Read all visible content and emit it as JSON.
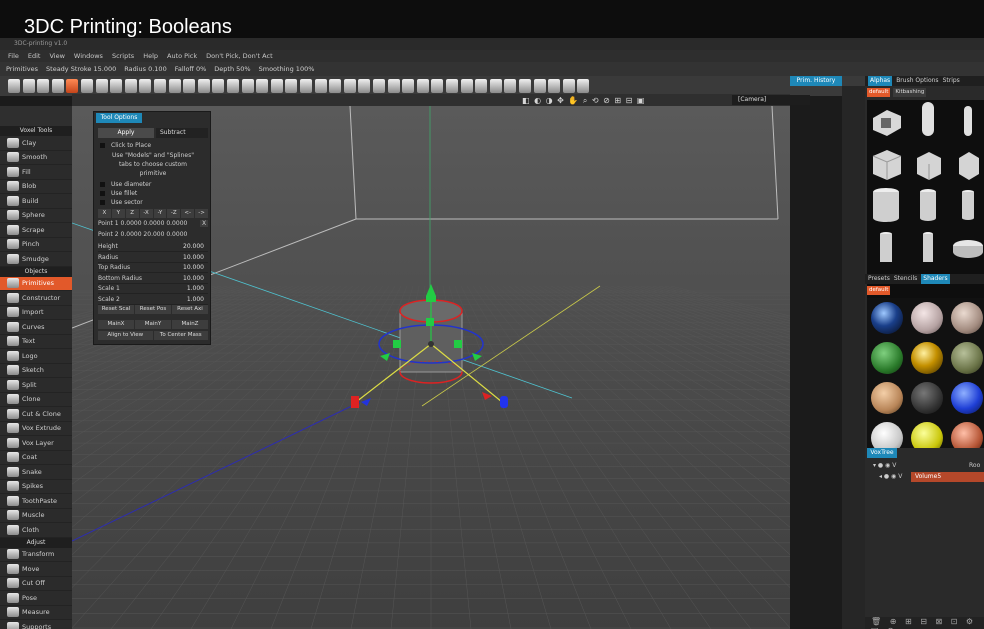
{
  "video": {
    "title": "3DC Printing: Booleans"
  },
  "app": {
    "title": "3DC-printing v1.0"
  },
  "menu": [
    "File",
    "Edit",
    "View",
    "Windows",
    "Scripts",
    "Help",
    "Auto Pick",
    "Don't Pick, Don't Act"
  ],
  "tool_row": [
    "Primitives",
    "Steady Stroke 15.000",
    "Radius 0.100",
    "Falloff 0%",
    "Depth 50%",
    "Smoothing 100%"
  ],
  "prim_history_tab": "Prim. History",
  "camera": "[Camera]",
  "left_panel": {
    "sections": [
      {
        "header": "Voxel Tools",
        "items": [
          "Clay",
          "Smooth",
          "Fill",
          "Blob",
          "Build",
          "Sphere",
          "Scrape",
          "Pinch",
          "Smudge"
        ]
      },
      {
        "header": "Objects",
        "items": [
          "Primitives",
          "Constructor",
          "Import",
          "Curves",
          "Text",
          "Logo",
          "Sketch",
          "Split",
          "Clone",
          "Cut & Clone",
          "Vox Extrude",
          "Vox Layer",
          "Coat",
          "Snake",
          "Spikes",
          "ToothPaste",
          "Muscle",
          "Cloth"
        ]
      },
      {
        "header": "Adjust",
        "items": [
          "Transform",
          "Move",
          "Cut Off",
          "Pose",
          "Measure",
          "Supports"
        ]
      }
    ],
    "active_item": "Primitives"
  },
  "tool_options": {
    "tab": "Tool Options",
    "apply_label": "Apply",
    "mode_label": "Subtract",
    "click_to_place": "Click to Place",
    "hint_lines": [
      "Use \"Models\" and \"Splines\"",
      "tabs to choose custom",
      "primitive"
    ],
    "checkboxes": [
      "Use diameter",
      "Use fillet",
      "Use sector"
    ],
    "axis_buttons": [
      "X",
      "Y",
      "Z",
      "-X",
      "-Y",
      "-Z",
      "<-",
      "->"
    ],
    "point1": "Point 1 0.0000  0.0000  0.0000",
    "point1_btn": "X",
    "point2": "Point 2 0.0000  20.000  0.0000",
    "params": [
      {
        "label": "Height",
        "value": "20.000"
      },
      {
        "label": "Radius",
        "value": "10.000"
      },
      {
        "label": "Top Radius",
        "value": "10.000"
      },
      {
        "label": "Bottom Radius",
        "value": "10.000"
      },
      {
        "label": "Scale 1",
        "value": "1.000"
      },
      {
        "label": "Scale 2",
        "value": "1.000"
      }
    ],
    "reset_buttons": [
      "Reset Scal",
      "Reset Pos",
      "Reset Axi"
    ],
    "main_buttons": [
      "MainX",
      "MainY",
      "MainZ"
    ],
    "align_buttons": [
      "Align to View",
      "To Center Mass"
    ]
  },
  "right_panel": {
    "top_tabs": [
      "Alphas",
      "Brush Options",
      "Strips"
    ],
    "alpha_sub": [
      "default",
      "Kitbashing"
    ],
    "shader_tabs": [
      "Presets",
      "Stencils",
      "Shaders"
    ],
    "shader_sub": [
      "default"
    ],
    "vox_tab": "VoxTree",
    "vox_rows": [
      "V",
      "V"
    ],
    "root_label": "Roo",
    "volume_name": "Volume5"
  },
  "colors": {
    "accent": "#1e88b8",
    "active": "#e2592a",
    "panel": "#2b2b2b"
  }
}
